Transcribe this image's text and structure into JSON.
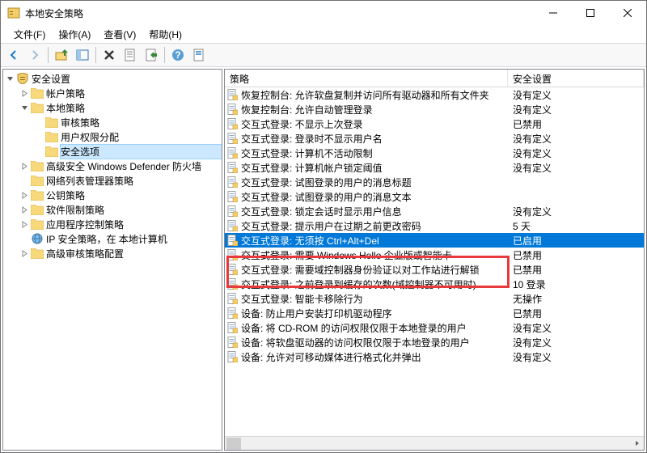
{
  "window": {
    "title": "本地安全策略"
  },
  "menu": [
    "文件(F)",
    "操作(A)",
    "查看(V)",
    "帮助(H)"
  ],
  "tree": {
    "root": "安全设置",
    "accountPolicy": "帐户策略",
    "localPolicy": "本地策略",
    "auditPolicy": "审核策略",
    "userRights": "用户权限分配",
    "securityOptions": "安全选项",
    "defender": "高级安全 Windows Defender 防火墙",
    "netList": "网络列表管理器策略",
    "pubKey": "公钥策略",
    "softRestrict": "软件限制策略",
    "appCtrl": "应用程序控制策略",
    "ipsec": "IP 安全策略，在 本地计算机",
    "advAudit": "高级审核策略配置"
  },
  "columns": {
    "policy": "策略",
    "setting": "安全设置"
  },
  "rows": [
    {
      "p": "恢复控制台: 允许软盘复制并访问所有驱动器和所有文件夹",
      "s": "没有定义"
    },
    {
      "p": "恢复控制台: 允许自动管理登录",
      "s": "没有定义"
    },
    {
      "p": "交互式登录: 不显示上次登录",
      "s": "已禁用"
    },
    {
      "p": "交互式登录: 登录时不显示用户名",
      "s": "没有定义"
    },
    {
      "p": "交互式登录: 计算机不活动限制",
      "s": "没有定义"
    },
    {
      "p": "交互式登录: 计算机帐户锁定阈值",
      "s": "没有定义"
    },
    {
      "p": "交互式登录: 试图登录的用户的消息标题",
      "s": ""
    },
    {
      "p": "交互式登录: 试图登录的用户的消息文本",
      "s": ""
    },
    {
      "p": "交互式登录: 锁定会话时显示用户信息",
      "s": "没有定义"
    },
    {
      "p": "交互式登录: 提示用户在过期之前更改密码",
      "s": "5 天"
    },
    {
      "p": "交互式登录: 无须按 Ctrl+Alt+Del",
      "s": "已启用",
      "sel": true
    },
    {
      "p": "交互式登录: 需要 Windows Hello 企业版或智能卡",
      "s": "已禁用"
    },
    {
      "p": "交互式登录: 需要域控制器身份验证以对工作站进行解锁",
      "s": "已禁用"
    },
    {
      "p": "交互式登录: 之前登录到缓存的次数(域控制器不可用时)",
      "s": "10 登录"
    },
    {
      "p": "交互式登录: 智能卡移除行为",
      "s": "无操作"
    },
    {
      "p": "设备: 防止用户安装打印机驱动程序",
      "s": "已禁用"
    },
    {
      "p": "设备: 将 CD-ROM 的访问权限仅限于本地登录的用户",
      "s": "没有定义"
    },
    {
      "p": "设备: 将软盘驱动器的访问权限仅限于本地登录的用户",
      "s": "没有定义"
    },
    {
      "p": "设备: 允许对可移动媒体进行格式化并弹出",
      "s": "没有定义"
    }
  ]
}
